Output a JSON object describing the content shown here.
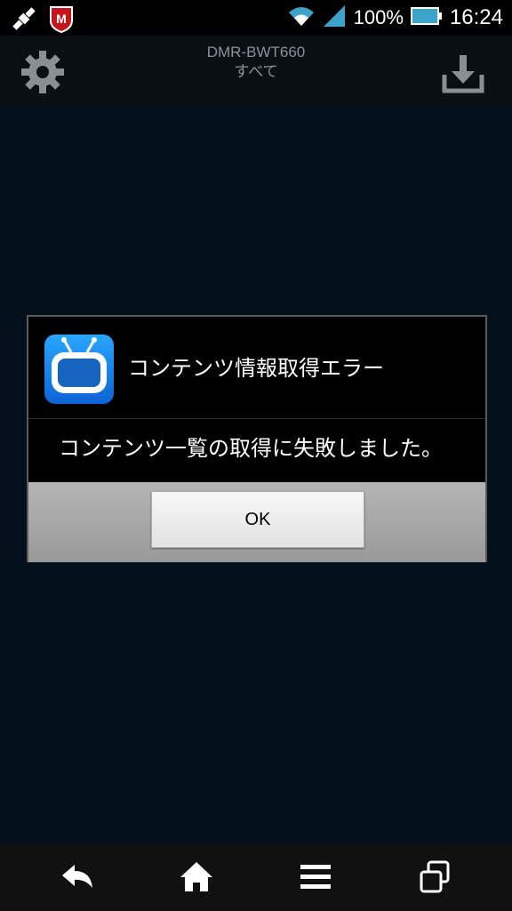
{
  "status_bar": {
    "battery_percent": "100%",
    "time": "16:24",
    "icons": [
      "satellite-icon",
      "mcafee-icon",
      "wifi-icon",
      "signal-icon",
      "battery-icon"
    ]
  },
  "app_bar": {
    "device_name": "DMR-BWT660",
    "category": "すべて",
    "icons": [
      "gear-icon",
      "download-icon"
    ]
  },
  "dialog": {
    "title": "コンテンツ情報取得エラー",
    "message": "コンテンツ一覧の取得に失敗しました。",
    "ok_label": "OK",
    "icon": "tv-app-icon"
  },
  "nav_bar": {
    "icons": [
      "back-icon",
      "home-icon",
      "menu-icon",
      "recent-apps-icon"
    ]
  },
  "colors": {
    "background": "#04101c",
    "dialog_bg": "#000000",
    "button_area": "#a8a8a8",
    "app_icon_blue": "#1e88f0"
  }
}
